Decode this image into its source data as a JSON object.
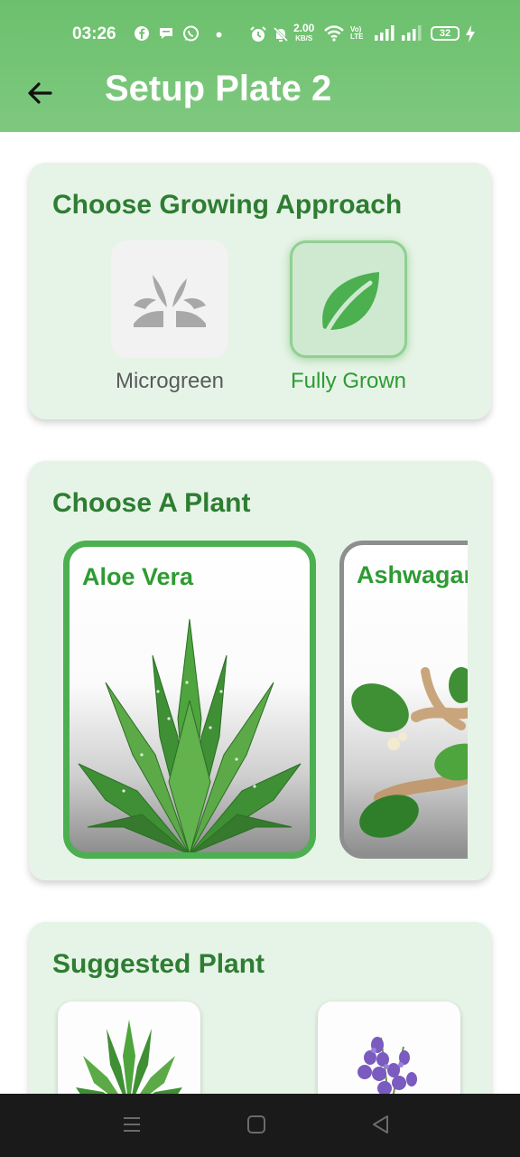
{
  "status_bar": {
    "time": "03:26",
    "net_speed_value": "2.00",
    "net_speed_unit": "KB/S",
    "volte_label": "Vo) LTE",
    "battery_level": "32"
  },
  "app_bar": {
    "title": "Setup Plate 2",
    "back_icon": "arrow-left-icon"
  },
  "growing_approach": {
    "title": "Choose Growing Approach",
    "options": [
      {
        "label": "Microgreen",
        "icon": "sprout-icon",
        "selected": false
      },
      {
        "label": "Fully Grown",
        "icon": "leaf-icon",
        "selected": true
      }
    ]
  },
  "choose_plant": {
    "title": "Choose A Plant",
    "plants": [
      {
        "name": "Aloe Vera",
        "selected": true
      },
      {
        "name": "Ashwagandha",
        "selected": false
      }
    ]
  },
  "suggested": {
    "title": "Suggested Plant",
    "items": [
      {
        "icon": "aloe-vera-icon"
      },
      {
        "icon": "lavender-icon"
      }
    ]
  },
  "colors": {
    "accent": "#4caf50",
    "app_bar": "#72c373",
    "card_bg": "#e6f4e7",
    "title_green": "#2e7d32"
  }
}
